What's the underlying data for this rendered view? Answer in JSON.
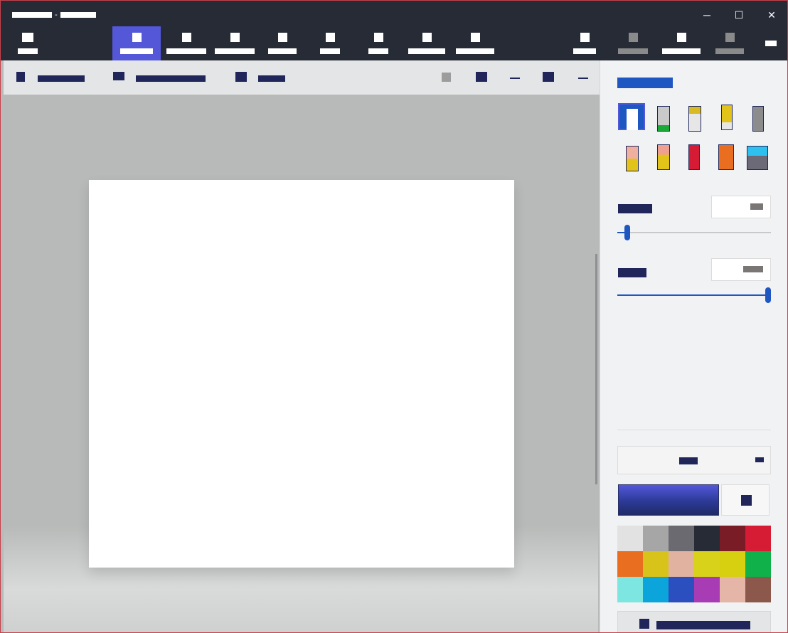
{
  "window": {
    "title_app": "▇▇▇▇▇▇▇▇",
    "title_separator": "-",
    "title_doc": "▇▇▇▇▇▇▇",
    "minimize_icon": "minimize-icon",
    "maximize_icon": "maximize-icon",
    "close_icon": "close-icon",
    "minimize_glyph": "─",
    "maximize_glyph": "☐",
    "close_glyph": "✕"
  },
  "ribbon": {
    "tools": [
      {
        "label": "▇▇▇▇",
        "icon": "menu-icon"
      },
      {
        "label": "▇▇▇▇▇▇",
        "icon": "brushes-icon",
        "active": true
      },
      {
        "label": "▇▇▇▇▇▇▇",
        "icon": "shapes-icon"
      },
      {
        "label": "▇▇▇▇▇▇▇",
        "icon": "stickers-icon"
      },
      {
        "label": "▇▇▇▇▇",
        "icon": "text-icon"
      },
      {
        "label": "▇▇▇▇",
        "icon": "effects-icon"
      },
      {
        "label": "▇▇▇▇",
        "icon": "canvas-icon"
      },
      {
        "label": "▇▇▇▇▇▇▇",
        "icon": "3d-library-icon"
      },
      {
        "label": "▇▇▇▇▇▇▇",
        "icon": "mixed-reality-icon"
      }
    ],
    "right_tools": [
      {
        "label": "▇▇▇▇",
        "icon": "paste-icon"
      },
      {
        "label": "▇▇▇▇▇▇",
        "icon": "undo-icon",
        "disabled": true
      },
      {
        "label": "▇▇▇▇▇▇▇",
        "icon": "history-icon"
      },
      {
        "label": "▇▇▇▇▇",
        "icon": "redo-icon",
        "disabled": true
      },
      {
        "label": "▇▇",
        "icon": "more-icon"
      }
    ]
  },
  "subtoolbar": {
    "items": [
      {
        "label": "▇▇▇▇▇▇▇▇",
        "icon": "select-icon"
      },
      {
        "label": "▇▇▇▇▇▇▇▇▇▇▇",
        "icon": "magic-select-icon"
      },
      {
        "label": "▇▇▇▇",
        "icon": "crop-icon"
      }
    ],
    "right_icons": [
      "view-3d-icon",
      "zoom-fit-icon",
      "zoom-out-icon",
      "zoom-level-icon",
      "zoom-in-icon"
    ]
  },
  "panel": {
    "title": "▇▇▇▇▇▇▇▇",
    "brushes": [
      {
        "name": "marker-brush",
        "selected": true
      },
      {
        "name": "calligraphy-pen-brush"
      },
      {
        "name": "oil-brush"
      },
      {
        "name": "watercolor-brush"
      },
      {
        "name": "pixel-pen-brush"
      },
      {
        "name": "pencil-brush"
      },
      {
        "name": "eraser-brush"
      },
      {
        "name": "crayon-brush"
      },
      {
        "name": "spray-can-brush"
      },
      {
        "name": "fill-brush"
      }
    ],
    "thickness_label": "▇▇▇▇▇",
    "thickness_value": "▇▇",
    "thickness_fraction": 0.05,
    "opacity_label": "▇▇▇▇▇",
    "opacity_value": "▇▇▇",
    "opacity_fraction": 1.0,
    "finish_label": "▇▇▇",
    "chevron_icon": "chevron-down-icon",
    "eyedropper_icon": "eyedropper-icon",
    "add_color_label": "▇▇▇▇▇▇▇▇▇▇▇▇",
    "add_color_icon": "add-color-icon",
    "current_color": "#2c3a96",
    "swatches": [
      "#e2e2e2",
      "#a6a6a6",
      "#6b6a70",
      "#262b36",
      "#7a1c26",
      "#d51c34",
      "#ea6e1f",
      "#d7c31a",
      "#e2b2a0",
      "#d9d21a",
      "#d7d010",
      "#10b04a",
      "#7ee6e0",
      "#0ba5dc",
      "#2c4fc0",
      "#a73cb4",
      "#e5b6a7",
      "#8d584c"
    ]
  }
}
